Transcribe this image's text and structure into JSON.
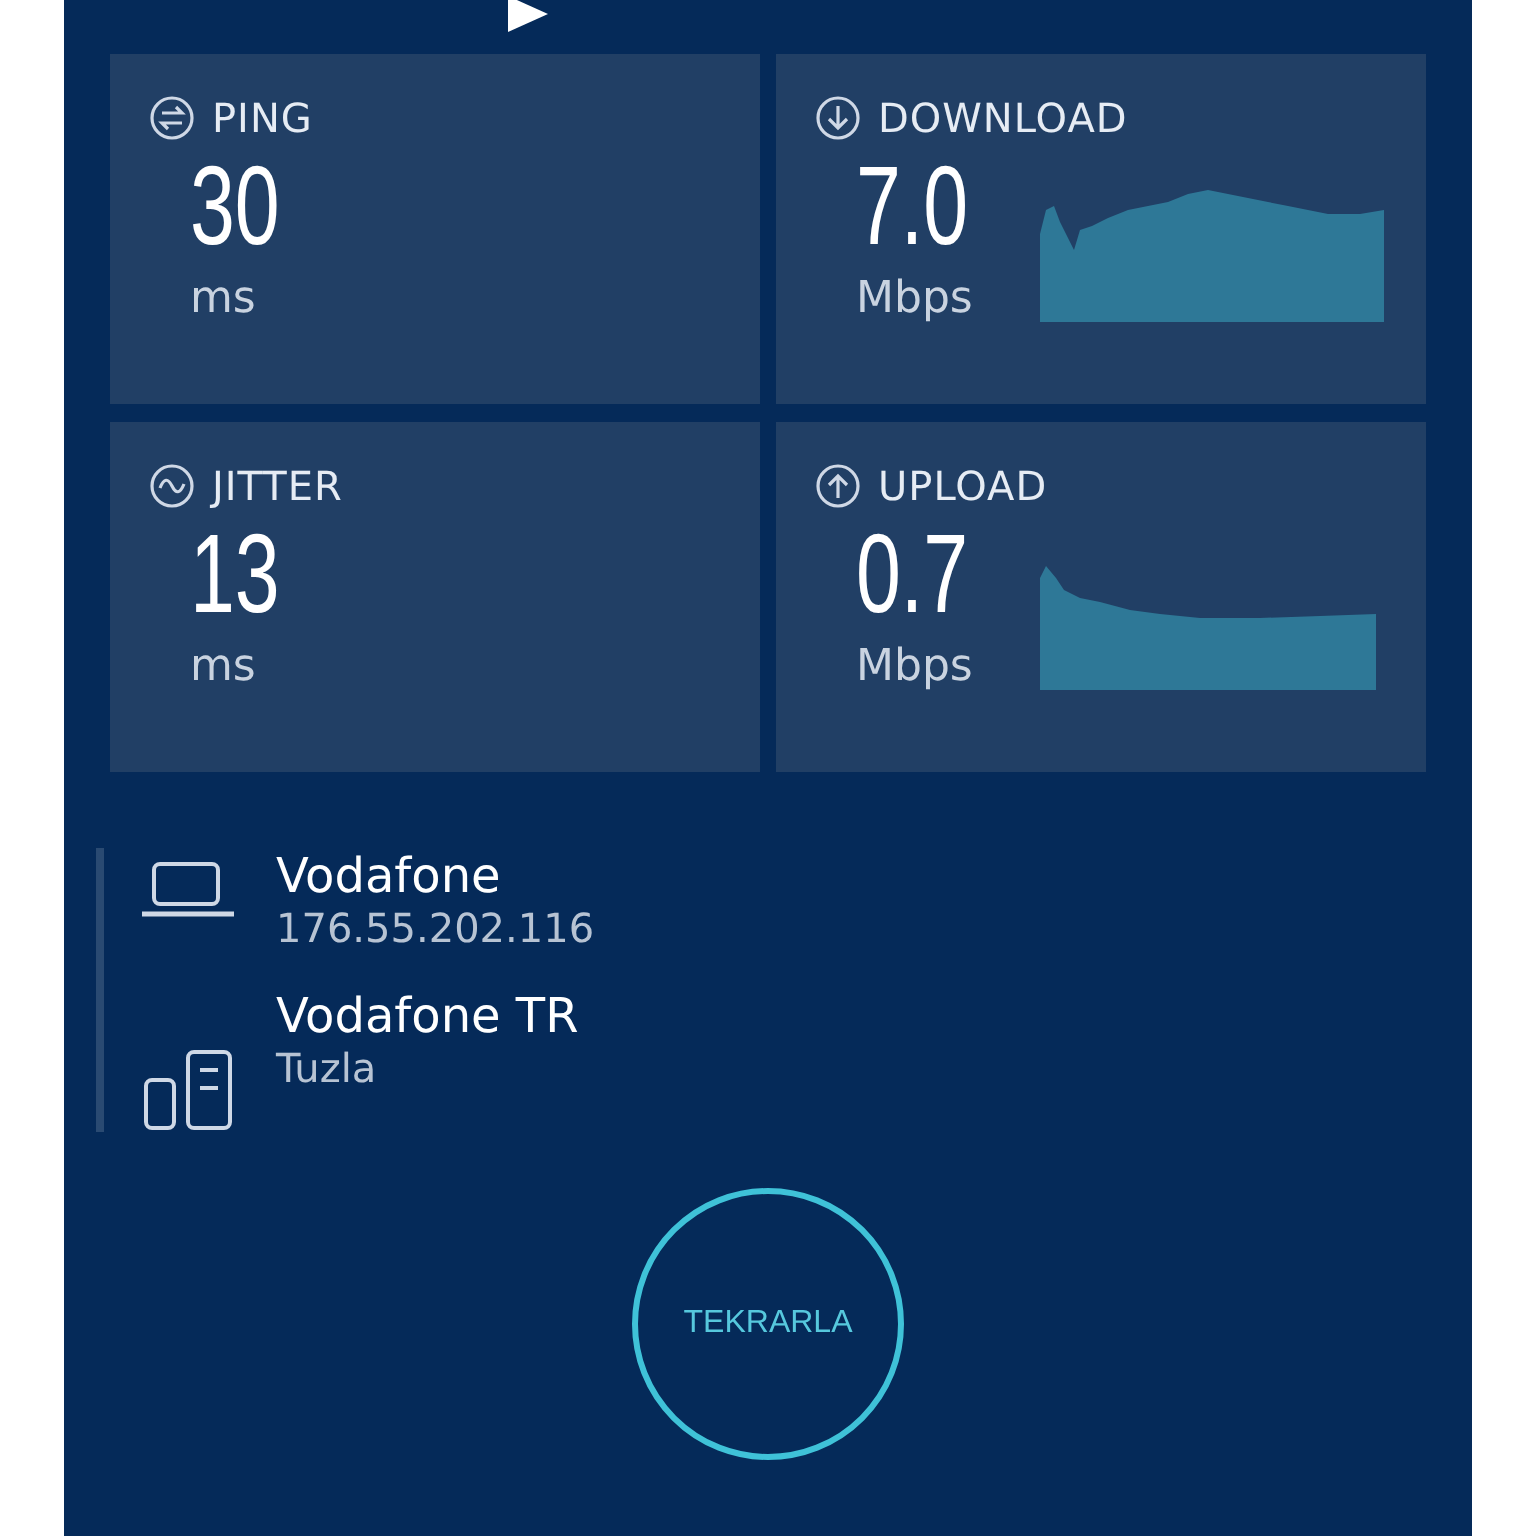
{
  "metrics": [
    {
      "kind": "ping",
      "label": "PING",
      "value": "30",
      "unit": "ms"
    },
    {
      "kind": "download",
      "label": "DOWNLOAD",
      "value": "7.0",
      "unit": "Mbps"
    },
    {
      "kind": "jitter",
      "label": "JITTER",
      "value": "13",
      "unit": "ms"
    },
    {
      "kind": "upload",
      "label": "UPLOAD",
      "value": "0.7",
      "unit": "Mbps"
    }
  ],
  "connection": [
    {
      "kind": "client",
      "name": "Vodafone",
      "detail": "176.55.202.116"
    },
    {
      "kind": "server",
      "name": "Vodafone TR",
      "detail": "Tuzla"
    }
  ],
  "button": "TEKRARLA"
}
